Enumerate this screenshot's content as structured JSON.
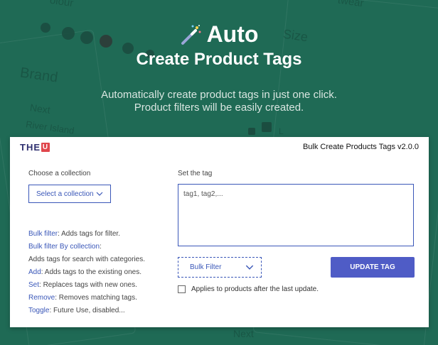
{
  "hero": {
    "title": "Auto",
    "subtitle": "Create Product Tags",
    "desc_line1": "Automatically create product tags in just one click.",
    "desc_line2": "Product filters will be easily created.",
    "icon": "magic-wand-icon"
  },
  "background": {
    "words": [
      "Brand",
      "Size",
      "Next",
      "River Island",
      "Next",
      "olour",
      "twear",
      "L"
    ]
  },
  "app": {
    "logo_text": "THE",
    "logo_mark": "U",
    "title": "Bulk Create Products Tags v2.0.0",
    "collection": {
      "label": "Choose a collection",
      "button_label": "Select a collection"
    },
    "tag": {
      "label": "Set the tag",
      "placeholder": "tag1, tag2,..."
    },
    "help": [
      {
        "key": "Bulk filter",
        "text": ": Adds tags for filter."
      },
      {
        "key": "Bulk filter By collection",
        "text": ":"
      },
      {
        "key": "",
        "text": "Adds tags for search with categories."
      },
      {
        "key": "Add",
        "text": ": Adds tags to the existing ones."
      },
      {
        "key": "Set",
        "text": ": Replaces tags with new ones."
      },
      {
        "key": "Remove",
        "text": ": Removes matching tags."
      },
      {
        "key": "Toggle",
        "text": ": Future Use, disabled..."
      }
    ],
    "mode_select": {
      "value": "Bulk Filter"
    },
    "update_button": "UPDATE TAG",
    "apply_checkbox": {
      "label": "Applies to products after the last update.",
      "checked": false
    }
  },
  "colors": {
    "background": "#1f6a55",
    "accent": "#3a57b8",
    "button": "#4f5cc6",
    "logo_red": "#e0474c"
  }
}
